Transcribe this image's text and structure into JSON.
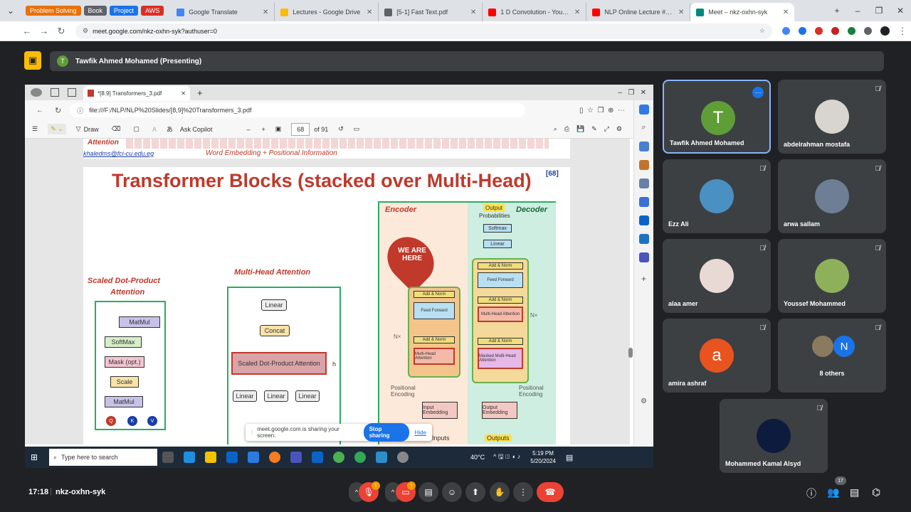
{
  "browser": {
    "bookmarks": [
      {
        "label": "Problem Solving",
        "color": "#e8710a"
      },
      {
        "label": "Book",
        "color": "#5f6368"
      },
      {
        "label": "Project",
        "color": "#1a73e8"
      },
      {
        "label": "AWS",
        "color": "#d93025"
      }
    ],
    "tabs": [
      {
        "title": "Google Translate",
        "fav": "#4285f4",
        "active": false
      },
      {
        "title": "Lectures - Google Drive",
        "fav": "#fbbc04",
        "active": false
      },
      {
        "title": "[5-1] Fast Text.pdf",
        "fav": "#5f6368",
        "active": false
      },
      {
        "title": "1 D Convolution - YouTube",
        "fav": "#ff0000",
        "active": false
      },
      {
        "title": "NLP Online Lecture #2 - YouTu",
        "fav": "#ff0000",
        "active": false
      },
      {
        "title": "Meet – nkz-oxhn-syk",
        "fav": "#00897b",
        "active": true
      }
    ],
    "url": "meet.google.com/nkz-oxhn-syk?authuser=0"
  },
  "meet": {
    "presenter_initial": "T",
    "presenter_label": "Tawfik Ahmed Mohamed (Presenting)",
    "meeting_code": "nkz-oxhn-syk",
    "time": "17:18",
    "people_count": "17",
    "mic_badge": "!",
    "cam_badge": "!"
  },
  "shared": {
    "edge_tab": "*[8.9] Transformers_3.pdf",
    "edge_url": "file:///F:/NLP/NLP%20Slides/[8,9]%20Transformers_3.pdf",
    "pdf_toolbar": {
      "draw": "Draw",
      "copilot": "Ask Copilot",
      "page": "68",
      "of": "of 91"
    },
    "page1": {
      "attention": "Attention",
      "email": "khaledms@fci-cu.edu.eg",
      "formula": "Word  Embedding  +  Positional  Information"
    },
    "slide": {
      "title": "Transformer Blocks (stacked over Multi-Head)",
      "ref": "[68]",
      "sdpa_title_1": "Scaled Dot-Product",
      "sdpa_title_2": "Attention",
      "sdpa_blocks": [
        "MatMul",
        "SoftMax",
        "Mask (opt.)",
        "Scale",
        "MatMul"
      ],
      "sdpa_inputs": [
        "Q",
        "K",
        "V"
      ],
      "mha_title": "Multi-Head Attention",
      "mha_blocks": [
        "Linear",
        "Concat",
        "Scaled Dot-Product Attention",
        "Linear",
        "Linear",
        "Linear"
      ],
      "mha_h": "h",
      "encoder": "Encoder",
      "decoder": "Decoder",
      "output": "Output",
      "probabilities": "Probabilities",
      "softmax": "Softmax",
      "linear": "Linear",
      "we_are_here": "WE ARE HERE",
      "enc_blocks": [
        "Add & Norm",
        "Feed Forward",
        "Add & Norm",
        "Multi-Head Attention"
      ],
      "dec_blocks": [
        "Add & Norm",
        "Feed Forward",
        "Add & Norm",
        "Multi-Head Attention",
        "Add & Norm",
        "Masked Multi-Head Attention"
      ],
      "nx": "N×",
      "pos_enc": "Positional Encoding",
      "input_emb": "Input Embedding",
      "output_emb": "Output Embedding",
      "inputs": "Inputs",
      "outputs": "Outputs"
    },
    "share_bar": {
      "text": "meet.google.com is sharing your screen.",
      "stop": "Stop sharing",
      "hide": "Hide"
    },
    "taskbar": {
      "search": "Type here to search",
      "temp": "40°C",
      "time": "5:19 PM",
      "date": "5/20/2024"
    }
  },
  "participants": [
    {
      "name": "Tawfik Ahmed Mohamed",
      "initial": "T",
      "color": "#5f9e36",
      "muted": false
    },
    {
      "name": "abdelrahman mostafa",
      "initial": "",
      "color": "#d8d4cf",
      "muted": true
    },
    {
      "name": "Ezz Ali",
      "initial": "",
      "color": "#4a90c2",
      "muted": true
    },
    {
      "name": "arwa sallam",
      "initial": "",
      "color": "#6d7e95",
      "muted": true
    },
    {
      "name": "alaa amer",
      "initial": "",
      "color": "#e8d9d5",
      "muted": true
    },
    {
      "name": "Youssef Mohammed",
      "initial": "",
      "color": "#8fb05a",
      "muted": true
    },
    {
      "name": "amira ashraf",
      "initial": "a",
      "color": "#e8531f",
      "muted": true
    },
    {
      "name": "8 others",
      "initial": "N",
      "color": "#1a73e8",
      "muted": true
    },
    {
      "name": "Mohammed Kamal Alsyd",
      "initial": "",
      "color": "#0d1b3e",
      "muted": true
    }
  ]
}
